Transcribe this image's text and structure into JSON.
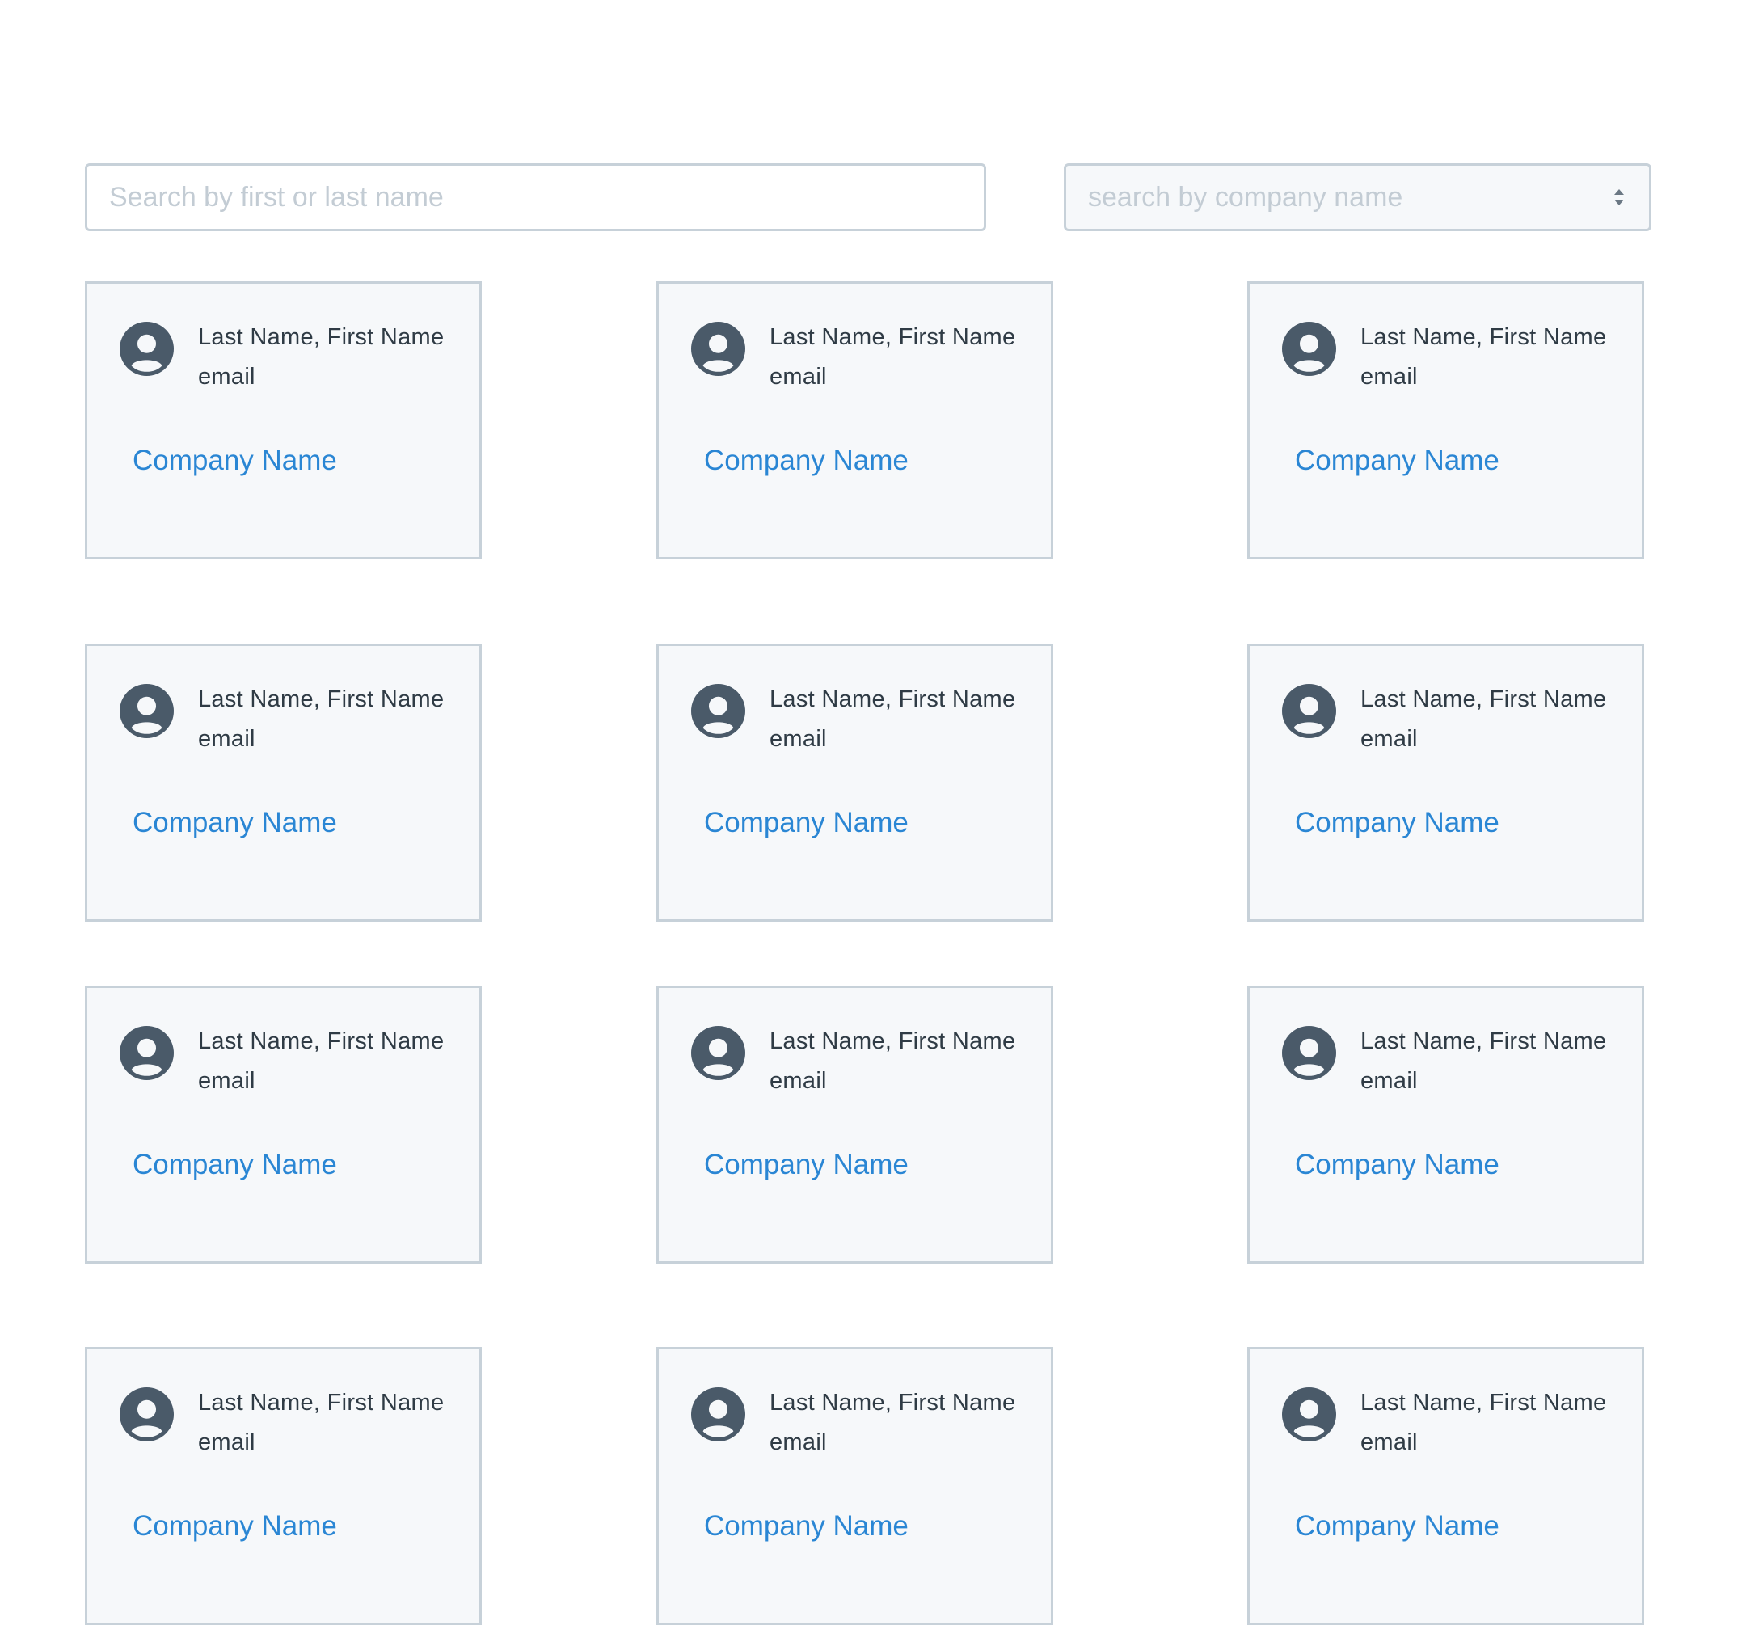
{
  "filters": {
    "name_search_placeholder": "Search by first or last name",
    "name_search_value": "",
    "company_select_value": "search by company name"
  },
  "contacts": [
    {
      "name": "Last Name, First Name",
      "email": "email",
      "company": "Company Name"
    },
    {
      "name": "Last Name, First Name",
      "email": "email",
      "company": "Company Name"
    },
    {
      "name": "Last Name, First Name",
      "email": "email",
      "company": "Company Name"
    },
    {
      "name": "Last Name, First Name",
      "email": "email",
      "company": "Company Name"
    },
    {
      "name": "Last Name, First Name",
      "email": "email",
      "company": "Company Name"
    },
    {
      "name": "Last Name, First Name",
      "email": "email",
      "company": "Company Name"
    },
    {
      "name": "Last Name, First Name",
      "email": "email",
      "company": "Company Name"
    },
    {
      "name": "Last Name, First Name",
      "email": "email",
      "company": "Company Name"
    },
    {
      "name": "Last Name, First Name",
      "email": "email",
      "company": "Company Name"
    },
    {
      "name": "Last Name, First Name",
      "email": "email",
      "company": "Company Name"
    },
    {
      "name": "Last Name, First Name",
      "email": "email",
      "company": "Company Name"
    },
    {
      "name": "Last Name, First Name",
      "email": "email",
      "company": "Company Name"
    }
  ],
  "icons": {
    "avatar": "user-circle-icon",
    "select_arrows": "sort-arrows-icon"
  },
  "colors": {
    "link": "#2a86d4",
    "text": "#2f3b45",
    "border": "#c7d1d9",
    "card_background": "#f6f8fa",
    "avatar": "#4a5a69"
  }
}
